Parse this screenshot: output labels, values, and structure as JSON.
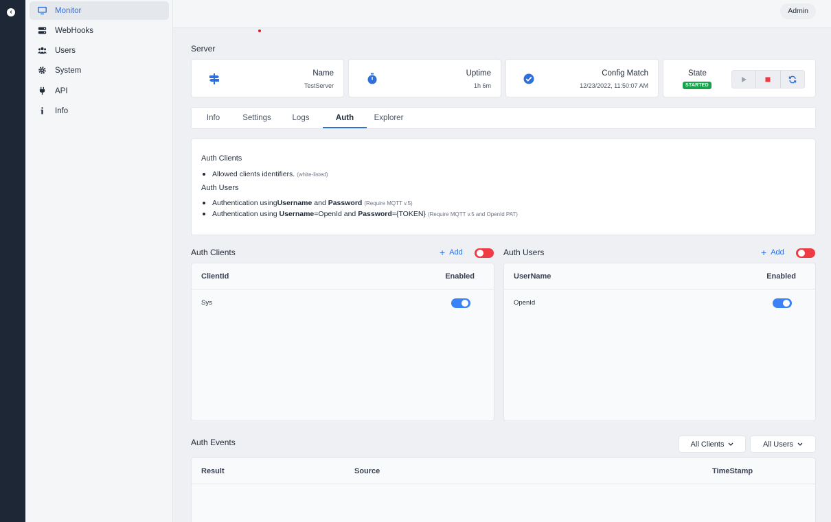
{
  "sidebar": {
    "items": [
      {
        "label": "Monitor",
        "icon": "monitor-icon",
        "active": true
      },
      {
        "label": "WebHooks",
        "icon": "server-icon"
      },
      {
        "label": "Users",
        "icon": "users-icon"
      },
      {
        "label": "System",
        "icon": "gear-icon"
      },
      {
        "label": "API",
        "icon": "plug-icon"
      },
      {
        "label": "Info",
        "icon": "info-icon"
      }
    ]
  },
  "header": {
    "user": "Admin"
  },
  "server": {
    "title": "Server",
    "cards": {
      "name": {
        "label": "Name",
        "value": "TestServer"
      },
      "uptime": {
        "label": "Uptime",
        "value": "1h 6m"
      },
      "config": {
        "label": "Config Match",
        "value": "12/23/2022, 11:50:07 AM"
      },
      "state": {
        "label": "State",
        "badge": "STARTED"
      }
    }
  },
  "tabs": [
    "Info",
    "Settings",
    "Logs",
    "Auth",
    "Explorer"
  ],
  "active_tab": "Auth",
  "info": {
    "clients_heading": "Auth Clients",
    "clients_item": "Allowed clients identifiers.",
    "clients_note": "(white-listed)",
    "users_heading": "Auth Users",
    "users_item1_a": "Authentication using ",
    "users_item1_b": "Username",
    "users_item1_c": " and ",
    "users_item1_d": "Password",
    "users_item1_note": "(Require MQTT v.5)",
    "users_item2_a": "Authentication using ",
    "users_item2_b": "Username",
    "users_item2_c": "=OpenId and ",
    "users_item2_d": "Password",
    "users_item2_e": "={TOKEN}",
    "users_item2_note": "(Require MQTT v.5 and OpenId PAT)"
  },
  "auth_clients": {
    "title": "Auth Clients",
    "add_label": "Add",
    "enabled": false,
    "columns": [
      "ClientId",
      "Enabled"
    ],
    "rows": [
      {
        "id": "Sys",
        "enabled": true
      }
    ]
  },
  "auth_users": {
    "title": "Auth Users",
    "add_label": "Add",
    "enabled": false,
    "columns": [
      "UserName",
      "Enabled"
    ],
    "rows": [
      {
        "id": "OpenId",
        "enabled": true
      }
    ]
  },
  "events": {
    "title": "Auth Events",
    "filter_clients": "All Clients",
    "filter_users": "All Users",
    "columns": [
      "Result",
      "Source",
      "TimeStamp"
    ]
  },
  "colors": {
    "accent": "#2f6fdc",
    "toggle_on": "#3b82f6",
    "toggle_off": "#ef3b44",
    "started": "#16a34a",
    "rail": "#1e2735"
  }
}
